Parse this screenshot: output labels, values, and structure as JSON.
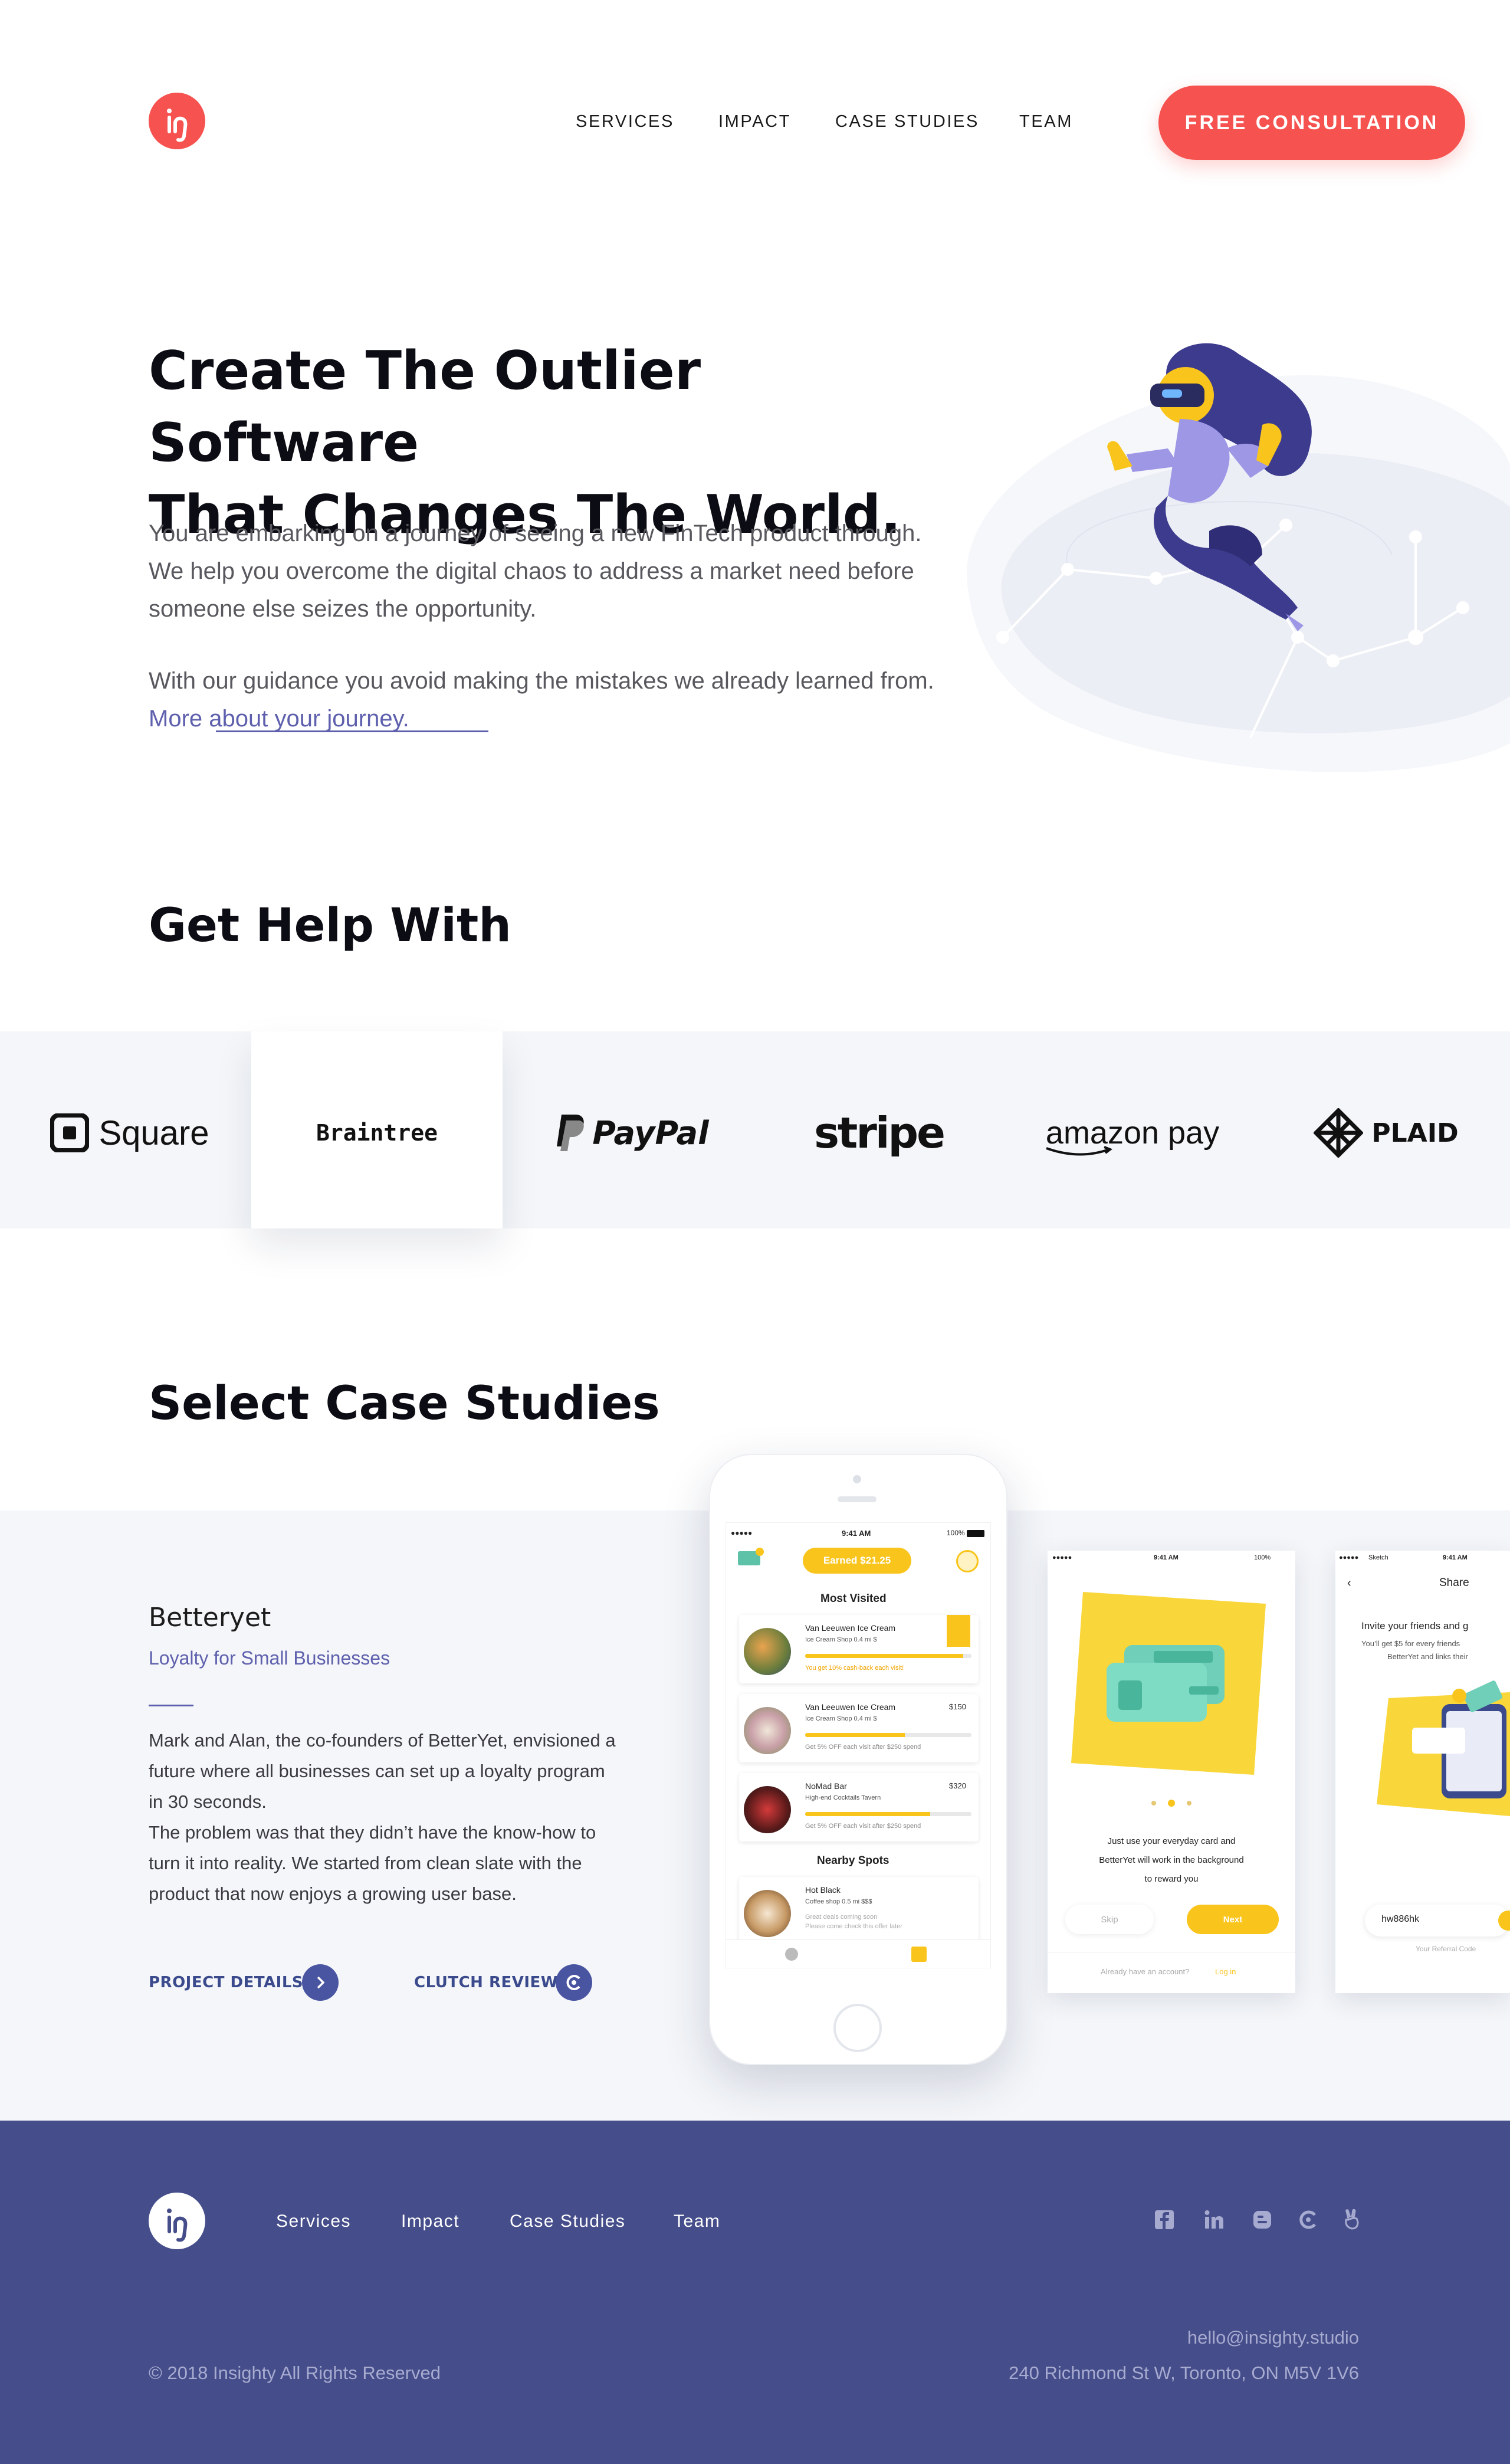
{
  "header": {
    "nav": [
      "SERVICES",
      "IMPACT",
      "CASE STUDIES",
      "TEAM"
    ],
    "cta": "FREE CONSULTATION"
  },
  "hero": {
    "title_line1": "Create The Outlier Software",
    "title_line2": "That Changes The World.",
    "para1_line1": "You are embarking on a journey of seeing a new FinTech product through.",
    "para1_line2": "We help you overcome the digital chaos to address a market need before",
    "para1_line3": "someone else seizes the opportunity.",
    "para2": "With our guidance you avoid making the mistakes we already learned from.",
    "more_link": "More about your journey."
  },
  "help": {
    "title": "Get Help With",
    "brands": [
      "Square",
      "Braintree",
      "PayPal",
      "stripe",
      "amazon pay",
      "PLAID"
    ]
  },
  "case_studies": {
    "title": "Select Case Studies",
    "name": "Betteryet",
    "subtitle": "Loyalty for Small Businesses",
    "body": [
      "Mark and Alan, the co-founders of BetterYet, envisioned a",
      "future where all businesses can set up a loyalty program",
      "in 30 seconds.",
      "The problem was that they didn’t have the know-how to",
      "turn it into reality. We started from clean slate with the",
      "product that now enjoys a growing user base."
    ],
    "project_details": "PROJECT DETAILS",
    "clutch_review": "CLUTCH REVIEW",
    "phone": {
      "time": "9:41 AM",
      "battery": "100%",
      "earned": "Earned $21.25",
      "most_visited": "Most Visited",
      "rows": [
        {
          "name": "Van Leeuwen Ice Cream",
          "sub": "Ice Cream Shop 0.4 mi $",
          "note": "You get 10% cash-back each visit!",
          "price": "",
          "progress": 0.95
        },
        {
          "name": "Van Leeuwen Ice Cream",
          "sub": "Ice Cream Shop 0.4 mi $",
          "note": "Get 5% OFF each visit after $250 spend",
          "price": "$150",
          "progress": 0.6
        },
        {
          "name": "NoMad Bar",
          "sub": "High-end Cocktails Tavern",
          "note": "Get 5% OFF each visit after $250 spend",
          "price": "$320",
          "progress": 0.75
        }
      ],
      "nearby": "Nearby Spots",
      "hot_name": "Hot Black",
      "hot_sub": "Coffee shop 0.5 mi $$$",
      "hot_note1": "Great deals coming soon",
      "hot_note2": "Please come check this offer later"
    },
    "screen2": {
      "time": "9:41 AM",
      "battery": "100%",
      "text1": "Just use your everyday card and",
      "text2": "BetterYet will work in the background",
      "text3": "to reward you",
      "skip": "Skip",
      "next": "Next",
      "login_prefix": "Already have an account?",
      "login": "Log in"
    },
    "screen3": {
      "carrier": "Sketch",
      "time": "9:41 AM",
      "title": "Share",
      "invite": "Invite your friends and g",
      "desc1": "You’ll get $5 for every friends",
      "desc2": "BetterYet and links their",
      "code": "hw886hk",
      "code_label": "Your Referral Code"
    }
  },
  "footer": {
    "links": [
      "Services",
      "Impact",
      "Case Studies",
      "Team"
    ],
    "copyright": "© 2018 Insighty All Rights Reserved",
    "email": "hello@insighty.studio",
    "address": "240 Richmond St W, Toronto, ON M5V 1V6",
    "social_icons": [
      "facebook-icon",
      "linkedin-icon",
      "blogger-icon",
      "clutch-icon",
      "angellist-icon"
    ]
  },
  "colors": {
    "accent": "#f6524f",
    "brand_purple": "#5e60ad",
    "footer_bg": "#454d8a",
    "band_bg": "#f4f6f9",
    "phone_yellow": "#f9c51c"
  }
}
